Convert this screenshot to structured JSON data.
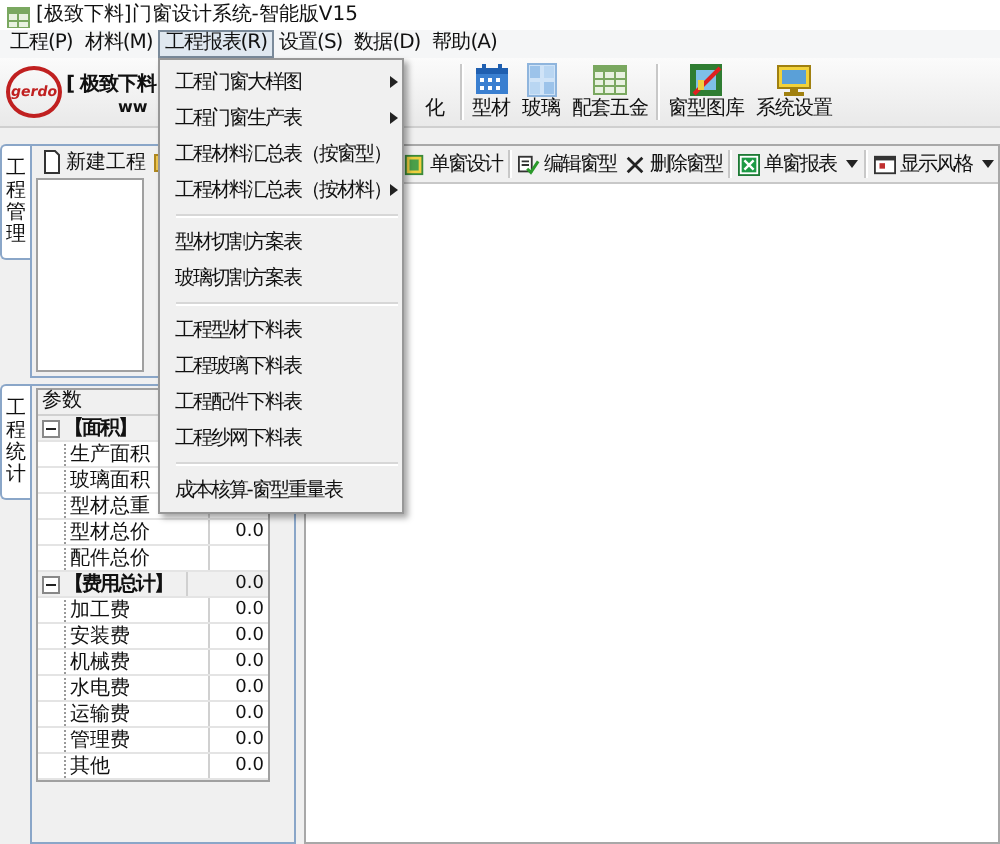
{
  "window": {
    "title": "[极致下料]门窗设计系统-智能版V15"
  },
  "menu_bar": [
    {
      "label": "工程(P)",
      "selected": false
    },
    {
      "label": "材料(M)",
      "selected": false
    },
    {
      "label": "工程报表(R)",
      "selected": true
    },
    {
      "label": "设置(S)",
      "selected": false
    },
    {
      "label": "数据(D)",
      "selected": false
    },
    {
      "label": "帮助(A)",
      "selected": false
    }
  ],
  "open_menu": {
    "groups": [
      [
        {
          "label": "工程门窗大样图",
          "submenu": true
        },
        {
          "label": "工程门窗生产表",
          "submenu": true
        },
        {
          "label": "工程材料汇总表（按窗型）",
          "submenu": false
        },
        {
          "label": "工程材料汇总表（按材料）",
          "submenu": true
        }
      ],
      [
        {
          "label": "型材切割方案表",
          "submenu": false
        },
        {
          "label": "玻璃切割方案表",
          "submenu": false
        }
      ],
      [
        {
          "label": "工程型材下料表",
          "submenu": false
        },
        {
          "label": "工程玻璃下料表",
          "submenu": false
        },
        {
          "label": "工程配件下料表",
          "submenu": false
        },
        {
          "label": "工程纱网下料表",
          "submenu": false
        }
      ],
      [
        {
          "label": "成本核算-窗型重量表",
          "submenu": false
        }
      ]
    ]
  },
  "toolbar": {
    "logo": {
      "mark": "gerdo",
      "name": "[ 极致下料",
      "url": "ww"
    },
    "groups": [
      [
        {
          "label": "化"
        }
      ],
      [
        {
          "label": "型材"
        },
        {
          "label": "玻璃"
        },
        {
          "label": "配套五金"
        }
      ],
      [
        {
          "label": "窗型图库"
        },
        {
          "label": "系统设置"
        }
      ]
    ]
  },
  "project_pane": {
    "tab": "工程管理",
    "toolbar": {
      "label": "新建工程"
    }
  },
  "stats_pane": {
    "tab": "工程统计",
    "grid": {
      "header": "参数",
      "groups": [
        {
          "label": "【面积】",
          "expanded": true,
          "rows": [
            {
              "name": "生产面积"
            },
            {
              "name": "玻璃面积"
            },
            {
              "name": "型材总重"
            },
            {
              "name": "型材总价",
              "value": "0.0"
            },
            {
              "name": "配件总价"
            }
          ]
        },
        {
          "label": "【费用总计】",
          "expanded": true,
          "value": "0.0",
          "rows": [
            {
              "name": "加工费",
              "value": "0.0"
            },
            {
              "name": "安装费",
              "value": "0.0"
            },
            {
              "name": "机械费",
              "value": "0.0"
            },
            {
              "name": "水电费",
              "value": "0.0"
            },
            {
              "name": "运输费",
              "value": "0.0"
            },
            {
              "name": "管理费",
              "value": "0.0"
            },
            {
              "name": "其他",
              "value": "0.0"
            }
          ]
        }
      ]
    }
  },
  "design_toolbar": [
    [
      {
        "label": "单窗设计",
        "dropdown": false
      }
    ],
    [
      {
        "label": "编辑窗型",
        "dropdown": false
      },
      {
        "label": "删除窗型",
        "dropdown": false
      }
    ],
    [
      {
        "label": "单窗报表",
        "dropdown": true
      }
    ],
    [
      {
        "label": "显示风格",
        "dropdown": true
      }
    ]
  ]
}
